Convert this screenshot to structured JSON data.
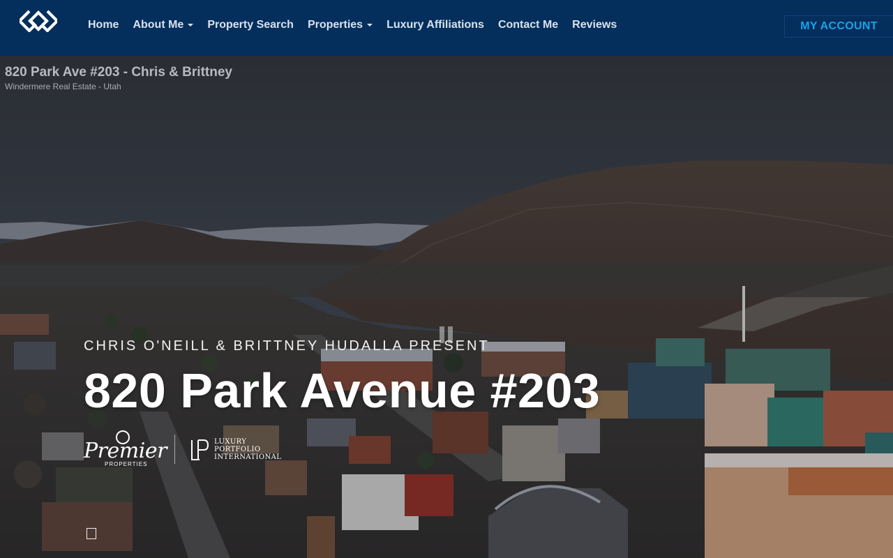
{
  "nav": {
    "items": [
      {
        "label": "Home",
        "dropdown": false
      },
      {
        "label": "About Me",
        "dropdown": true
      },
      {
        "label": "Property Search",
        "dropdown": false
      },
      {
        "label": "Properties",
        "dropdown": true
      },
      {
        "label": "Luxury Affiliations",
        "dropdown": false
      },
      {
        "label": "Contact Me",
        "dropdown": false
      },
      {
        "label": "Reviews",
        "dropdown": false
      }
    ],
    "account_label": "MY ACCOUNT"
  },
  "video": {
    "title": "820 Park Ave #203 - Chris & Brittney",
    "channel": "Windermere Real Estate - Utah"
  },
  "hero": {
    "presenter": "CHRIS O'NEILL & BRITTNEY HUDALLA PRESENT",
    "headline": "820 Park Avenue #203"
  },
  "logos": {
    "premier": "Premier",
    "premier_sub": "PROPERTIES",
    "lpi_line1": "LUXURY",
    "lpi_line2": "PORTFOLIO",
    "lpi_line3": "INTERNATIONAL"
  },
  "colors": {
    "nav_bg": "#042e5c",
    "account_text": "#1aa3e8"
  },
  "icons": {
    "logo": "windermere-diamond-logo",
    "pause": "pause-icon",
    "stop": "stop-icon"
  }
}
